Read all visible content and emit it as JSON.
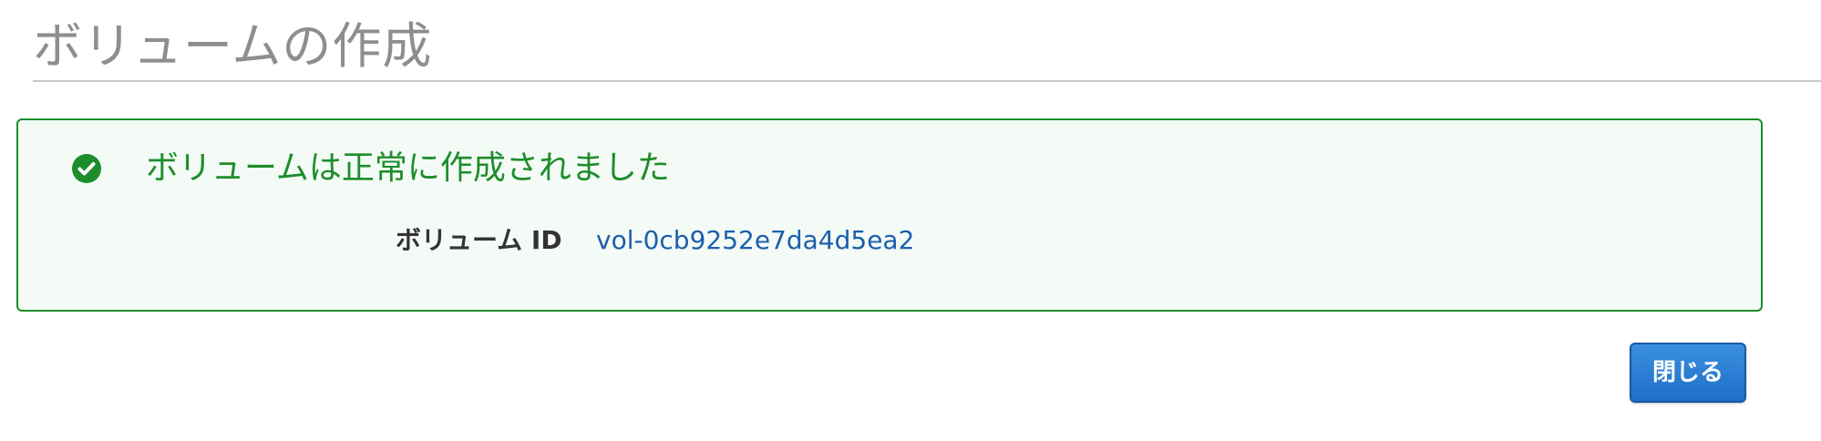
{
  "header": {
    "title": "ボリュームの作成"
  },
  "status": {
    "message": "ボリュームは正常に作成されました",
    "icon": "check-circle-icon",
    "color": "#1d8d2b",
    "background": "#f4fbf6"
  },
  "volume": {
    "label": "ボリューム ID",
    "id": "vol-0cb9252e7da4d5ea2",
    "link_color": "#1b5fad"
  },
  "actions": {
    "close_label": "閉じる",
    "close_color": "#2a7bd4"
  }
}
